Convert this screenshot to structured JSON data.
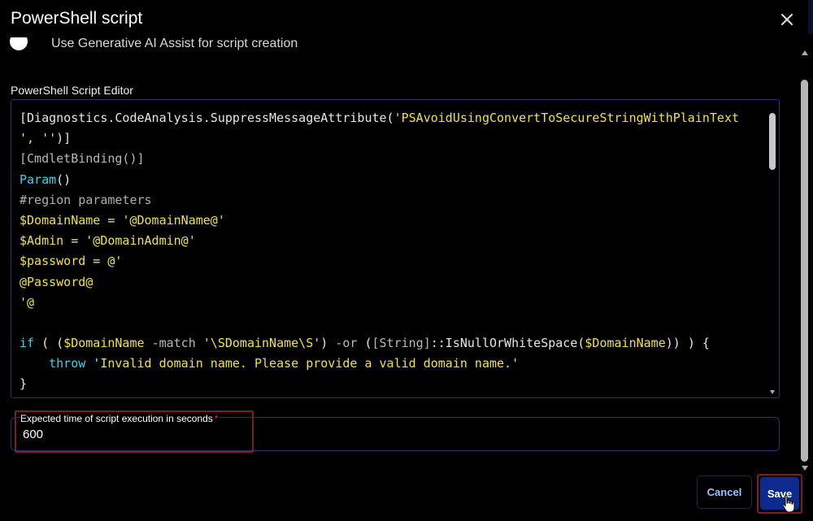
{
  "dialog": {
    "title": "PowerShell script"
  },
  "ai_assist": {
    "label": "Use Generative AI Assist for script creation"
  },
  "editor": {
    "label": "PowerShell Script Editor",
    "lines": [
      [
        {
          "t": "[Diagnostics.CodeAnalysis.SuppressMessageAttribute(",
          "c": "plain"
        },
        {
          "t": "'PSAvoidUsingConvertToSecureStringWithPlainText",
          "c": "str"
        }
      ],
      [
        {
          "t": "', ''",
          "c": "str"
        },
        {
          "t": ")]",
          "c": "plain"
        }
      ],
      [
        {
          "t": "[CmdletBinding()]",
          "c": "type"
        }
      ],
      [
        {
          "t": "Param",
          "c": "kw"
        },
        {
          "t": "()",
          "c": "plain"
        }
      ],
      [
        {
          "t": "#region parameters",
          "c": "comment"
        }
      ],
      [
        {
          "t": "$DomainName",
          "c": "var"
        },
        {
          "t": " = ",
          "c": "plain"
        },
        {
          "t": "'@DomainName@'",
          "c": "str"
        }
      ],
      [
        {
          "t": "$Admin",
          "c": "var"
        },
        {
          "t": " = ",
          "c": "plain"
        },
        {
          "t": "'@DomainAdmin@'",
          "c": "str"
        }
      ],
      [
        {
          "t": "$password",
          "c": "var"
        },
        {
          "t": " = ",
          "c": "plain"
        },
        {
          "t": "@'",
          "c": "str"
        }
      ],
      [
        {
          "t": "@Password@",
          "c": "str"
        }
      ],
      [
        {
          "t": "'@",
          "c": "str"
        }
      ],
      [
        {
          "t": "",
          "c": "plain"
        }
      ],
      [
        {
          "t": "if",
          "c": "kw"
        },
        {
          "t": " ( (",
          "c": "plain"
        },
        {
          "t": "$DomainName",
          "c": "var"
        },
        {
          "t": " -match ",
          "c": "op"
        },
        {
          "t": "'\\SDomainName\\S'",
          "c": "str"
        },
        {
          "t": ") ",
          "c": "plain"
        },
        {
          "t": "-or",
          "c": "op"
        },
        {
          "t": " (",
          "c": "plain"
        },
        {
          "t": "[String]",
          "c": "type"
        },
        {
          "t": "::IsNullOrWhiteSpace(",
          "c": "plain"
        },
        {
          "t": "$DomainName",
          "c": "var"
        },
        {
          "t": ")) ) {",
          "c": "plain"
        }
      ],
      [
        {
          "t": "    ",
          "c": "plain"
        },
        {
          "t": "throw",
          "c": "kw"
        },
        {
          "t": " ",
          "c": "plain"
        },
        {
          "t": "'Invalid domain name. Please provide a valid domain name.'",
          "c": "str"
        }
      ],
      [
        {
          "t": "}",
          "c": "plain"
        }
      ]
    ]
  },
  "execution_time": {
    "label": "Expected time of script execution in seconds",
    "required_marker": "*",
    "value": "600"
  },
  "footer": {
    "cancel_label": "Cancel",
    "save_label": "Save"
  }
}
